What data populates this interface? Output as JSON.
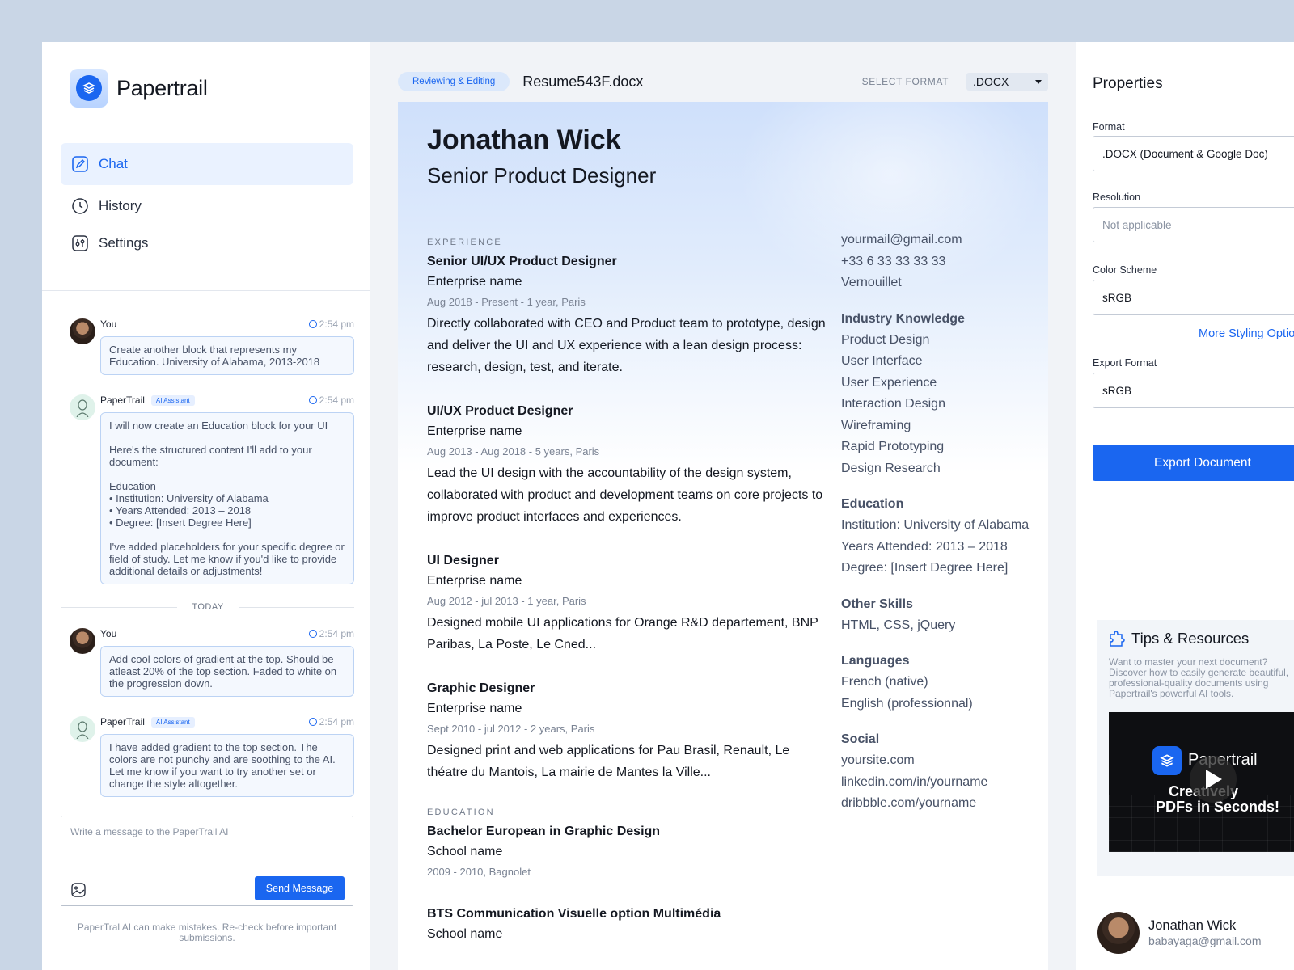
{
  "sidebar": {
    "brand": "Papertrail",
    "nav": [
      {
        "label": "Chat",
        "icon": "edit-icon"
      },
      {
        "label": "History",
        "icon": "clock-icon"
      },
      {
        "label": "Settings",
        "icon": "sliders-icon"
      }
    ],
    "messages": [
      {
        "author": "You",
        "time": "2:54 pm",
        "text": "Create another block that represents my Education. University of Alabama, 2013-2018"
      },
      {
        "author": "PaperTrail",
        "badge": "AI Assistant",
        "time": "2:54 pm",
        "text": "I will now create an Education block for your UI\n\nHere's the structured content I'll add to your document:\n\nEducation\n  •  Institution: University of Alabama\n  •  Years Attended: 2013 – 2018\n  •  Degree: [Insert Degree Here]\n\nI've added placeholders for your specific degree or field of study. Let me know if you'd like to provide additional details or adjustments!"
      }
    ],
    "divider_label": "TODAY",
    "messages_today": [
      {
        "author": "You",
        "time": "2:54 pm",
        "text": "Add cool colors of gradient at the top. Should be atleast 20% of the top section. Faded to white on the progression down."
      },
      {
        "author": "PaperTrail",
        "badge": "AI Assistant",
        "time": "2:54 pm",
        "text": "I have added gradient to the top section. The colors are not punchy and are soothing to the AI. Let me know if you want to try another set or change the style altogether."
      }
    ],
    "composer_placeholder": "Write a message to the PaperTrail AI",
    "send_label": "Send Message",
    "disclaimer": "PaperTral AI can make mistakes. Re-check before important submissions."
  },
  "main": {
    "status": "Reviewing & Editing",
    "file_name": "Resume543F.docx",
    "select_label": "SELECT FORMAT",
    "select_value": ".DOCX"
  },
  "resume": {
    "name": "Jonathan Wick",
    "role": "Senior Product Designer",
    "experience_label": "EXPERIENCE",
    "jobs": [
      {
        "title": "Senior UI/UX Product Designer",
        "company": "Enterprise name",
        "dates": "Aug 2018 - Present - 1 year, Paris",
        "desc": "Directly collaborated with CEO and Product team to prototype, design and deliver the UI and UX experience with a lean design process: research, design, test, and iterate."
      },
      {
        "title": "UI/UX Product Designer",
        "company": "Enterprise name",
        "dates": "Aug 2013 - Aug 2018 - 5 years, Paris",
        "desc": "Lead the UI design with the accountability of the design system, collaborated with product and development teams on core projects to improve product interfaces and experiences."
      },
      {
        "title": "UI Designer",
        "company": "Enterprise name",
        "dates": "Aug 2012 - jul 2013 - 1 year, Paris",
        "desc": "Designed mobile UI applications for Orange R&D departement, BNP Paribas, La Poste, Le Cned..."
      },
      {
        "title": "Graphic Designer",
        "company": "Enterprise name",
        "dates": "Sept 2010 - jul 2012 - 2 years, Paris",
        "desc": "Designed print and web applications for Pau Brasil, Renault, Le théatre du Mantois, La mairie de Mantes la Ville..."
      }
    ],
    "education_label": "EDUCATION",
    "education": [
      {
        "title": "Bachelor European in Graphic Design",
        "company": "School name",
        "dates": "2009 - 2010, Bagnolet"
      },
      {
        "title": "BTS Communication Visuelle option Multimédia",
        "company": "School name"
      }
    ],
    "contact": [
      "yourmail@gmail.com",
      "+33 6 33 33 33 33",
      "Vernouillet"
    ],
    "sections": [
      {
        "heading": "Industry Knowledge",
        "items": [
          "Product Design",
          "User Interface",
          "User Experience",
          "Interaction Design",
          "Wireframing",
          "Rapid Prototyping",
          "Design Research"
        ]
      },
      {
        "heading": "Education",
        "items": [
          "Institution: University of Alabama",
          "Years Attended: 2013 – 2018",
          "Degree: [Insert Degree Here]"
        ]
      },
      {
        "heading": "Other Skills",
        "items": [
          "HTML, CSS, jQuery"
        ]
      },
      {
        "heading": "Languages",
        "items": [
          "French (native)",
          "English (professionnal)"
        ]
      },
      {
        "heading": "Social",
        "items": [
          "yoursite.com",
          "linkedin.com/in/yourname",
          "dribbble.com/yourname"
        ]
      }
    ]
  },
  "properties": {
    "title": "Properties",
    "format_label": "Format",
    "format_value": ".DOCX (Document & Google Doc)",
    "resolution_label": "Resolution",
    "resolution_placeholder": "Not applicable",
    "color_label": "Color Scheme",
    "color_value": "sRGB",
    "more_link": "More Styling Options",
    "export_format_label": "Export Format",
    "export_format_value": "sRGB",
    "export_button": "Export Document",
    "tips_title": "Tips & Resources",
    "tips_text": "Want to master your next document? Discover how to easily generate beautiful, professional-quality documents using Papertrail's powerful AI tools.",
    "video_brand": "Papertrail",
    "video_line1": "Creatively",
    "video_line2": "PDFs in Seconds!",
    "user_name": "Jonathan Wick",
    "user_email": "babayaga@gmail.com"
  },
  "colors": {
    "accent": "#1a66f0",
    "page_bg": "#c9d6e6"
  }
}
